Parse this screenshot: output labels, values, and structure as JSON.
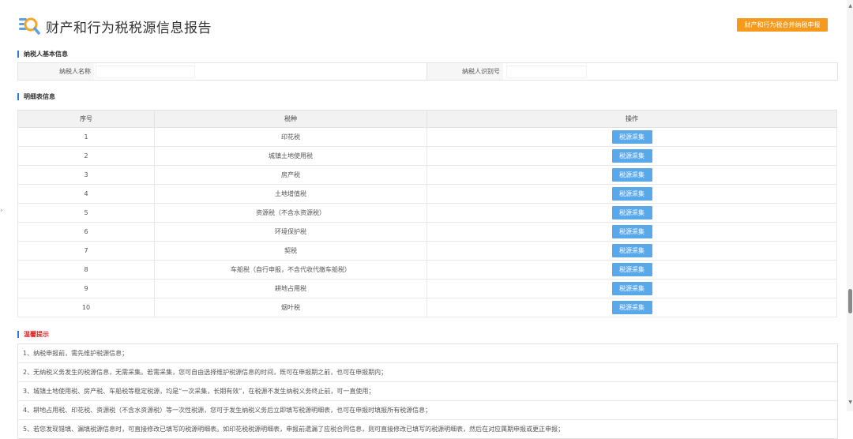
{
  "header": {
    "title": "财产和行为税税源信息报告",
    "action_button": "财产和行为税合并纳税申报",
    "logo_icon": "search-document-icon"
  },
  "sections": {
    "basic_info": "纳税人基本信息",
    "detail": "明细表信息",
    "tips": "温馨提示"
  },
  "basic_info": {
    "name_label": "纳税人名称",
    "name_value": "",
    "id_label": "纳税人识别号",
    "id_value": ""
  },
  "table": {
    "headers": [
      "序号",
      "税种",
      "操作"
    ],
    "rows": [
      {
        "no": "1",
        "tax": "印花税",
        "action": "税源采集"
      },
      {
        "no": "2",
        "tax": "城镇土地使用税",
        "action": "税源采集"
      },
      {
        "no": "3",
        "tax": "房产税",
        "action": "税源采集"
      },
      {
        "no": "4",
        "tax": "土地增值税",
        "action": "税源采集"
      },
      {
        "no": "5",
        "tax": "资源税（不含水资源税）",
        "action": "税源采集"
      },
      {
        "no": "6",
        "tax": "环境保护税",
        "action": "税源采集"
      },
      {
        "no": "7",
        "tax": "契税",
        "action": "税源采集"
      },
      {
        "no": "8",
        "tax": "车船税（自行申报，不含代收代缴车船税）",
        "action": "税源采集"
      },
      {
        "no": "9",
        "tax": "耕地占用税",
        "action": "税源采集"
      },
      {
        "no": "10",
        "tax": "烟叶税",
        "action": "税源采集"
      }
    ]
  },
  "tips": [
    "1、纳税申报前，需先维护税源信息；",
    "2、无纳税义务发生的税源信息，无需采集。若需采集，您可自由选择维护税源信息的时间，既可在申报期之前，也可在申报期内；",
    "3、城镇土地使用税、房产税、车船税等稳定税源，均是“一次采集，长期有效”，在税源不发生纳税义务终止前，可一直使用；",
    "4、耕地占用税、印花税、资源税（不含水资源税）等一次性税源，您可于发生纳税义务后立即填写税源明细表，也可在申报时填报所有税源信息；",
    "5、若您发现错填、漏填税源信息时，可直接修改已填写的税源明细表。如印花税税源明细表，申报前遗漏了应税合同信息，则可直接修改已填写的税源明细表，然后在对应属期申报或更正申报；"
  ],
  "colors": {
    "accent_blue": "#2b7cd3",
    "button_blue": "#58a8ea",
    "button_orange": "#f59a1c",
    "warn_red": "#e02020"
  }
}
